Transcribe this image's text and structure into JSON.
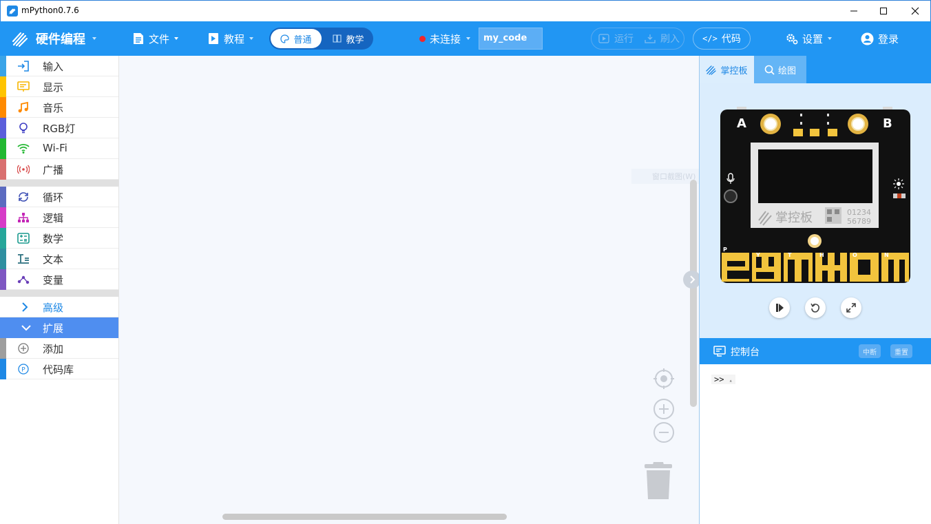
{
  "window": {
    "title": "mPython0.7.6"
  },
  "header": {
    "logo_label": "硬件编程",
    "file_menu": "文件",
    "tutorial_menu": "教程",
    "mode_normal": "普通",
    "mode_teach": "教学",
    "connection_status": "未连接",
    "filename": "my_code",
    "run_label": "运行",
    "flash_label": "刷入",
    "code_label": "代码",
    "settings_label": "设置",
    "login_label": "登录"
  },
  "sidebar": {
    "items": [
      {
        "label": "输入",
        "color": "#3aa4e8",
        "icon": "input-icon"
      },
      {
        "label": "显示",
        "color": "#ffc400",
        "icon": "display-icon"
      },
      {
        "label": "音乐",
        "color": "#ff8a00",
        "icon": "music-icon"
      },
      {
        "label": "RGB灯",
        "color": "#5b5fdb",
        "icon": "bulb-icon"
      },
      {
        "label": "Wi-Fi",
        "color": "#23b832",
        "icon": "wifi-icon"
      },
      {
        "label": "广播",
        "color": "#d97070",
        "icon": "broadcast-icon"
      },
      {
        "label": "循环",
        "color": "#5c6bc0",
        "icon": "loop-icon"
      },
      {
        "label": "逻辑",
        "color": "#d63cc7",
        "icon": "logic-icon"
      },
      {
        "label": "数学",
        "color": "#26a69a",
        "icon": "math-icon"
      },
      {
        "label": "文本",
        "color": "#2f8fa0",
        "icon": "text-icon"
      },
      {
        "label": "变量",
        "color": "#7e57c2",
        "icon": "variable-icon"
      }
    ],
    "advanced_label": "高级",
    "extend_label": "扩展",
    "extras": [
      {
        "label": "添加",
        "color": "#9e9e9e",
        "icon": "add-icon"
      },
      {
        "label": "代码库",
        "color": "#1e88e5",
        "icon": "library-icon"
      }
    ]
  },
  "panel": {
    "tab_board": "掌控板",
    "tab_draw": "绘图",
    "board": {
      "button_a": "A",
      "button_b": "B",
      "logo_text": "掌控板",
      "digits_top": "01234",
      "digits_bottom": "56789",
      "pin_letters": [
        "P",
        "Y",
        "T",
        "H",
        "O",
        "N"
      ]
    },
    "console_title": "控制台",
    "interrupt_label": "中断",
    "reset_label": "重置",
    "prompt": ">>"
  },
  "workspace": {
    "tooltip": "窗口截图(W)"
  },
  "colors": {
    "accent": "#2196f3",
    "board_black": "#111111",
    "gold": "#f2c43d"
  }
}
